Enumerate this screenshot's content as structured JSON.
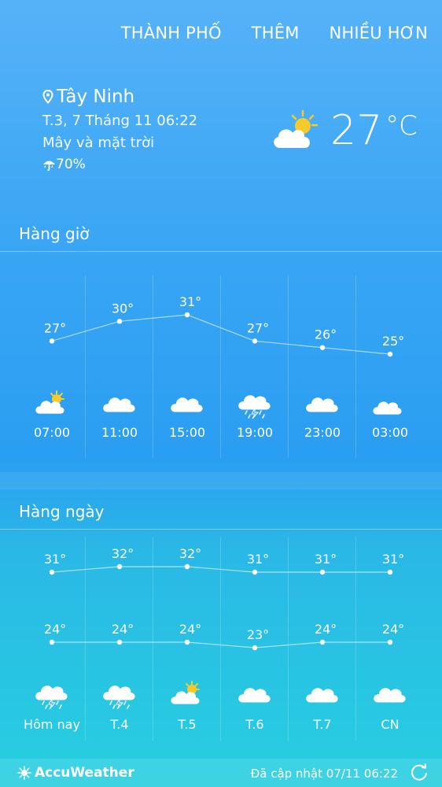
{
  "nav": {
    "city": "THÀNH PHỐ",
    "add": "THÊM",
    "more": "NHIỀU HƠN"
  },
  "current": {
    "city": "Tây Ninh",
    "datetime": "T.3, 7 Tháng 11 06:22",
    "condition": "Mây và mặt trời",
    "precip": "70%",
    "temp": "27",
    "unit": "°C",
    "icon": "partly-sunny-icon"
  },
  "hourly": {
    "title": "Hàng giờ",
    "items": [
      {
        "time": "07:00",
        "temp": "27°",
        "value": 27,
        "icon": "partly-sunny"
      },
      {
        "time": "11:00",
        "temp": "30°",
        "value": 30,
        "icon": "cloudy"
      },
      {
        "time": "15:00",
        "temp": "31°",
        "value": 31,
        "icon": "cloudy"
      },
      {
        "time": "19:00",
        "temp": "27°",
        "value": 27,
        "icon": "thunderstorm"
      },
      {
        "time": "23:00",
        "temp": "26°",
        "value": 26,
        "icon": "cloudy"
      },
      {
        "time": "03:00",
        "temp": "25°",
        "value": 25,
        "icon": "partly-cloudy-night"
      }
    ]
  },
  "daily": {
    "title": "Hàng ngày",
    "items": [
      {
        "day": "Hôm nay",
        "high": "31°",
        "low": "24°",
        "high_v": 31,
        "low_v": 24,
        "icon": "thunderstorm"
      },
      {
        "day": "T.4",
        "high": "32°",
        "low": "24°",
        "high_v": 32,
        "low_v": 24,
        "icon": "thunderstorm"
      },
      {
        "day": "T.5",
        "high": "32°",
        "low": "24°",
        "high_v": 32,
        "low_v": 24,
        "icon": "partly-sunny"
      },
      {
        "day": "T.6",
        "high": "31°",
        "low": "23°",
        "high_v": 31,
        "low_v": 23,
        "icon": "cloudy"
      },
      {
        "day": "T.7",
        "high": "31°",
        "low": "24°",
        "high_v": 31,
        "low_v": 24,
        "icon": "cloudy"
      },
      {
        "day": "CN",
        "high": "31°",
        "low": "24°",
        "high_v": 31,
        "low_v": 24,
        "icon": "cloudy"
      }
    ]
  },
  "footer": {
    "brand": "AccuWeather",
    "updated": "Đã cập nhật 07/11 06:22"
  },
  "colors": {
    "background_top": "#56b2f8",
    "background_bottom": "#27cfe0",
    "sun": "#f7c92a",
    "cloud": "#ffffff"
  }
}
